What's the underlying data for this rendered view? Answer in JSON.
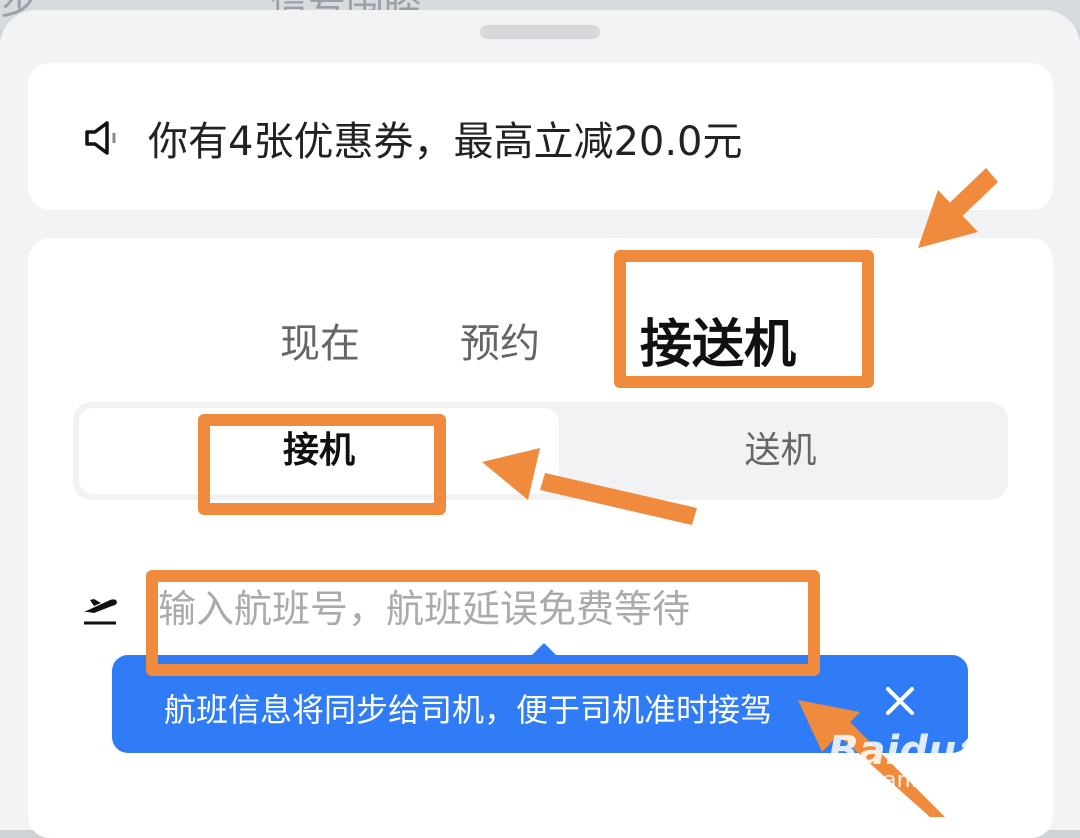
{
  "background": {
    "map_label": "信号围睦",
    "map_left_glyph": "步"
  },
  "coupon": {
    "icon": "speaker-icon",
    "text": "你有4张优惠券，最高立减20.0元"
  },
  "mode_tabs": [
    {
      "label": "现在",
      "active": false
    },
    {
      "label": "预约",
      "active": false
    },
    {
      "label": "接送机",
      "active": true
    }
  ],
  "segment": {
    "pickup_label": "接机",
    "dropoff_label": "送机",
    "selected": "接机"
  },
  "flight": {
    "icon": "plane-takeoff-icon",
    "placeholder": "输入航班号，航班延误免费等待",
    "value": ""
  },
  "tooltip": {
    "text": "航班信息将同步给司机，便于司机准时接驾",
    "close_icon": "close-icon"
  },
  "watermark": {
    "brand": "Baidu经验",
    "url": "jingyan.baidu.com"
  },
  "colors": {
    "accent_blue": "#2f7cf6",
    "highlight_orange": "#f08a3c",
    "card_bg": "#ffffff",
    "sheet_bg": "#f2f3f5"
  }
}
